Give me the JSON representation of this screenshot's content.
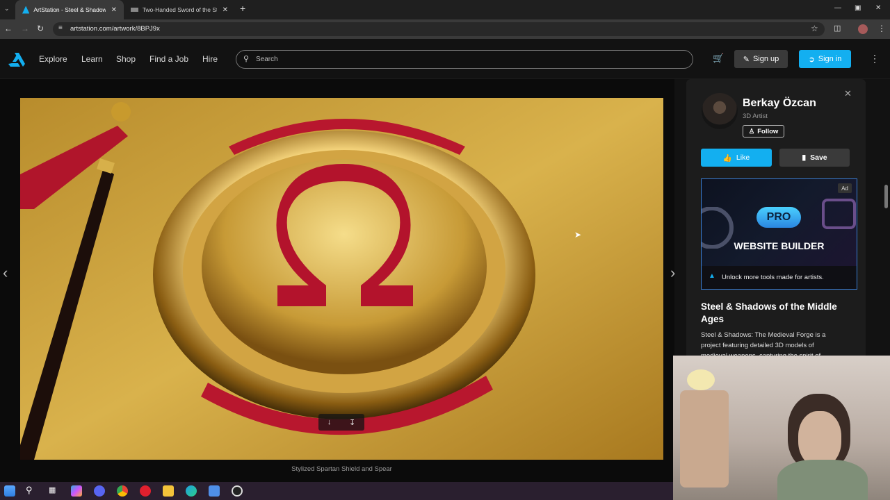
{
  "browser": {
    "tabs": [
      {
        "title": "ArtStation - Steel & Shadows o",
        "active": true
      },
      {
        "title": "Two-Handed Sword of the Stat",
        "active": false
      }
    ],
    "url": "artstation.com/artwork/8BPJ9x"
  },
  "header": {
    "nav": [
      "Explore",
      "Learn",
      "Shop",
      "Find a Job",
      "Hire"
    ],
    "search_placeholder": "Search",
    "signup_label": "Sign up",
    "signin_label": "Sign in",
    "accent": "#13aff0"
  },
  "artwork": {
    "caption": "Stylized Spartan Shield and Spear"
  },
  "sidebar": {
    "artist_name": "Berkay Özcan",
    "artist_role": "3D Artist",
    "follow_label": "Follow",
    "like_label": "Like",
    "save_label": "Save",
    "ad": {
      "badge": "Ad",
      "pro": "PRO",
      "headline": "WEBSITE BUILDER",
      "tagline": "Unlock more tools made for artists."
    },
    "project_title": "Steel & Shadows of the Middle Ages",
    "project_desc": "Steel & Shadows: The Medieval Forge is a project featuring detailed 3D models of medieval weapons, capturing the spirit of"
  }
}
